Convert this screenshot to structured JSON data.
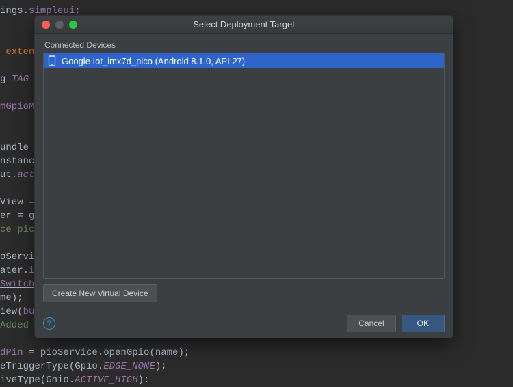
{
  "code": {
    "line1_a": "ings.",
    "line1_b": "simpleui",
    "line1_c": ";",
    "line3_a": " ",
    "line3_b": "extends",
    "line5_a": "g ",
    "line5_b": "TAG",
    "line7_a": "m",
    "line7_b": "GpioM",
    "line10_a": "undle s",
    "line11_a": "nstance",
    "line12_a": "ut.",
    "line12_b": "acti",
    "line14_a": "View = ",
    "line15_a": "er = ge",
    "line16_a": "ce pic",
    "line18_a": "oServic",
    "line19_a": "ater.",
    "line19_b": "in",
    "line20_a": "Switch",
    "line20_b": ")",
    "line21_a": "me);",
    "line22_a": "iew(",
    "line22_b": "but",
    "line23_a": "Added",
    "line25_a": "dPin",
    "line25_b": " = pioService.openGpio(name);",
    "line26_a": "eTriggerType(Gpio.",
    "line26_b": "EDGE_NONE",
    "line26_c": ");",
    "line27_a": "iveType(Gnio.",
    "line27_b": "ACTIVE_HIGH",
    "line27_c": "):"
  },
  "dialog": {
    "title": "Select Deployment Target",
    "section_label": "Connected Devices",
    "device": {
      "label": "Google Iot_imx7d_pico (Android 8.1.0, API 27)"
    },
    "create_vd_label": "Create New Virtual Device",
    "help_glyph": "?",
    "cancel_label": "Cancel",
    "ok_label": "OK"
  }
}
